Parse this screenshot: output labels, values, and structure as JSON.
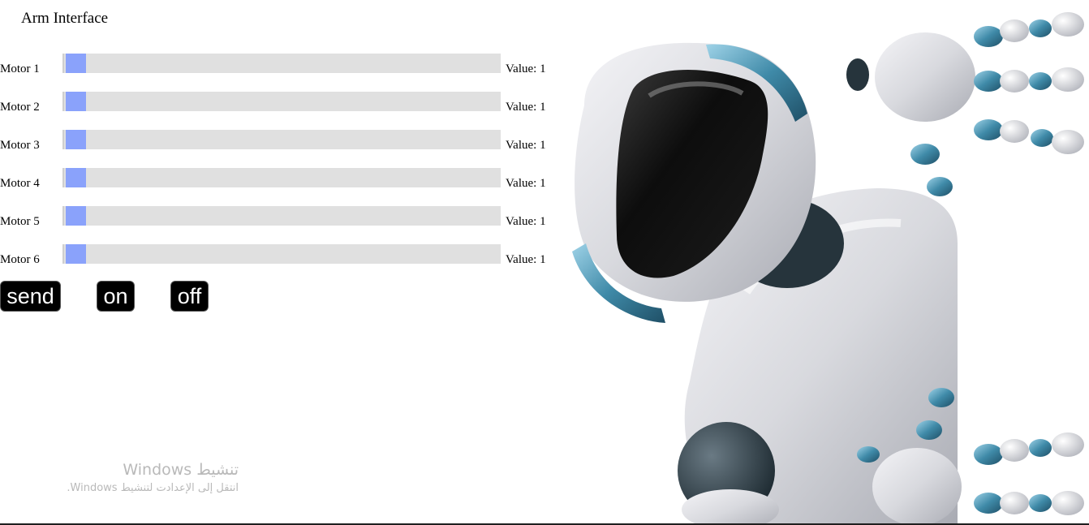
{
  "page": {
    "title": "Arm Interface"
  },
  "motors": [
    {
      "label": "Motor 1",
      "value_text": "Value: 1",
      "value": 1
    },
    {
      "label": "Motor 2",
      "value_text": "Value: 1",
      "value": 1
    },
    {
      "label": "Motor 3",
      "value_text": "Value: 1",
      "value": 1
    },
    {
      "label": "Motor 4",
      "value_text": "Value: 1",
      "value": 1
    },
    {
      "label": "Motor 5",
      "value_text": "Value: 1",
      "value": 1
    },
    {
      "label": "Motor 6",
      "value_text": "Value: 1",
      "value": 1
    }
  ],
  "buttons": {
    "send": "send",
    "on": "on",
    "off": "off"
  },
  "colors": {
    "slider_track": "#e0e0e0",
    "slider_thumb": "#8aa2fb",
    "button_bg": "#000000",
    "button_text": "#ffffff"
  },
  "image": {
    "subject": "white-robot-peeking-illustration"
  },
  "watermark": {
    "title": "تنشيط Windows",
    "subtitle": "انتقل إلى الإعدادت لتنشيط Windows."
  }
}
